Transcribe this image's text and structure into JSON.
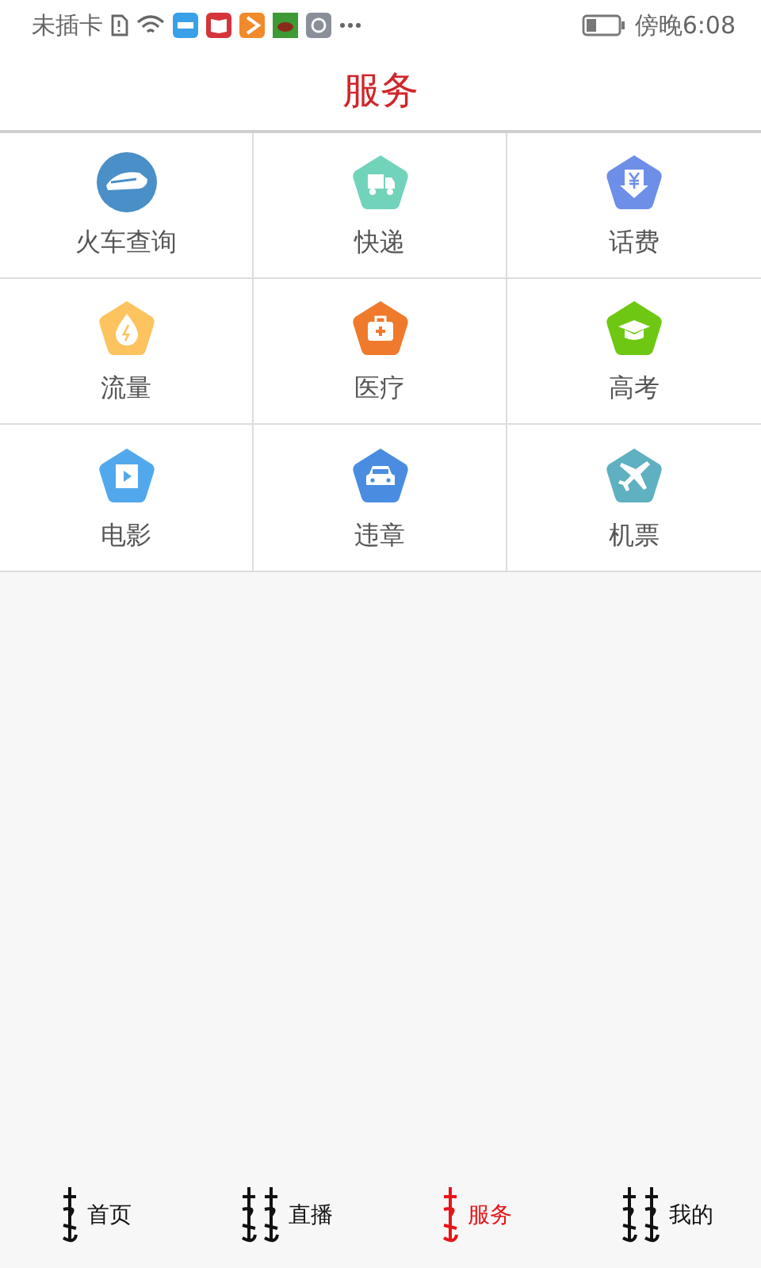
{
  "status_bar": {
    "carrier": "未插卡",
    "time": "傍晚6:08"
  },
  "header": {
    "title": "服务"
  },
  "services": [
    {
      "label": "火车查询",
      "kind": "train",
      "color": "#4a8fc7"
    },
    {
      "label": "快递",
      "kind": "truck",
      "color": "#72d3bb"
    },
    {
      "label": "话费",
      "kind": "yen",
      "color": "#6d8fe8"
    },
    {
      "label": "流量",
      "kind": "drop",
      "color": "#fdc35f"
    },
    {
      "label": "医疗",
      "kind": "medkit",
      "color": "#f07a2c"
    },
    {
      "label": "高考",
      "kind": "cap",
      "color": "#6ec813"
    },
    {
      "label": "电影",
      "kind": "film",
      "color": "#52a8ec"
    },
    {
      "label": "违章",
      "kind": "car",
      "color": "#4a8de0"
    },
    {
      "label": "机票",
      "kind": "plane",
      "color": "#5fb0c0"
    }
  ],
  "nav": [
    {
      "label": "首页",
      "selected": false
    },
    {
      "label": "直播",
      "selected": false
    },
    {
      "label": "服务",
      "selected": true
    },
    {
      "label": "我的",
      "selected": false
    }
  ]
}
